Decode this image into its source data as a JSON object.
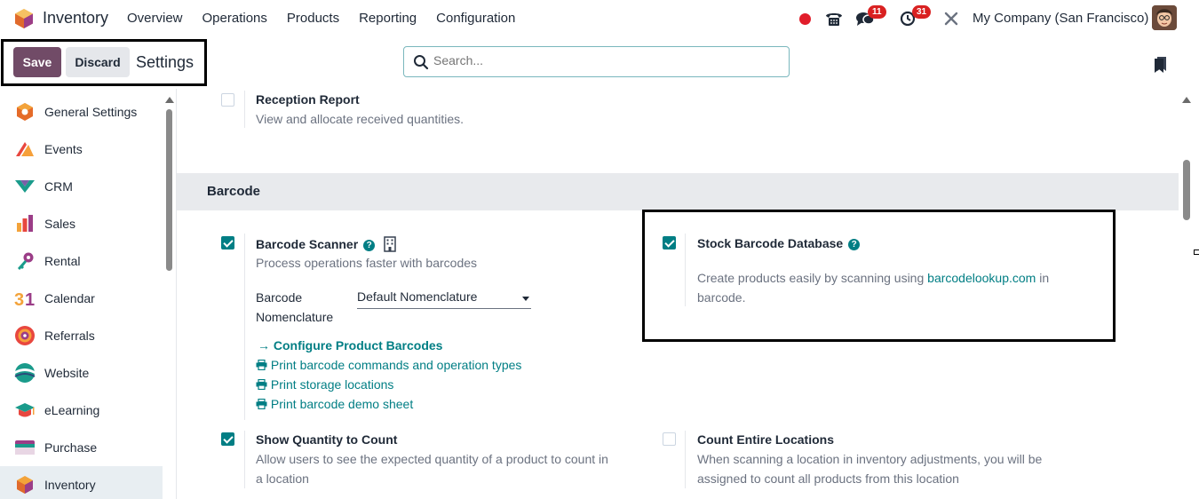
{
  "navbar": {
    "app_name": "Inventory",
    "menu": [
      "Overview",
      "Operations",
      "Products",
      "Reporting",
      "Configuration"
    ],
    "messages_count": "11",
    "activities_count": "31",
    "company": "My Company (San Francisco)"
  },
  "control_panel": {
    "save_label": "Save",
    "discard_label": "Discard",
    "title": "Settings",
    "search_placeholder": "Search..."
  },
  "sidebar": {
    "items": [
      {
        "label": "General Settings",
        "icon": "general-settings-icon"
      },
      {
        "label": "Events",
        "icon": "events-icon"
      },
      {
        "label": "CRM",
        "icon": "crm-icon"
      },
      {
        "label": "Sales",
        "icon": "sales-icon"
      },
      {
        "label": "Rental",
        "icon": "rental-icon"
      },
      {
        "label": "Calendar",
        "icon": "calendar-icon"
      },
      {
        "label": "Referrals",
        "icon": "referrals-icon"
      },
      {
        "label": "Website",
        "icon": "website-icon"
      },
      {
        "label": "eLearning",
        "icon": "elearning-icon"
      },
      {
        "label": "Purchase",
        "icon": "purchase-icon"
      },
      {
        "label": "Inventory",
        "icon": "inventory-icon",
        "active": true
      }
    ]
  },
  "content": {
    "reception_report": {
      "title": "Reception Report",
      "desc": "View and allocate received quantities.",
      "checked": false
    },
    "section_title": "Barcode",
    "barcode_scanner": {
      "title": "Barcode Scanner",
      "desc": "Process operations faster with barcodes",
      "checked": true,
      "nomenclature_label_1": "Barcode",
      "nomenclature_label_2": "Nomenclature",
      "nomenclature_value": "Default Nomenclature",
      "links": {
        "configure": "Configure Product Barcodes",
        "print_commands": "Print barcode commands and operation types",
        "print_locations": "Print storage locations",
        "print_demo": "Print barcode demo sheet"
      }
    },
    "stock_barcode_db": {
      "title": "Stock Barcode Database",
      "desc_before": "Create products easily by scanning using ",
      "desc_link": "barcodelookup.com",
      "desc_after": " in",
      "desc_line2": "barcode.",
      "checked": true
    },
    "show_quantity": {
      "title": "Show Quantity to Count",
      "desc_line1": "Allow users to see the expected quantity of a product to count in",
      "desc_line2": "a location",
      "checked": true
    },
    "count_entire": {
      "title": "Count Entire Locations",
      "desc_line1": "When scanning a location in inventory adjustments, you will be",
      "desc_line2": "assigned to count all products from this location",
      "checked": false
    }
  },
  "colors": {
    "brand": "#714b67",
    "accent": "#017e84",
    "badge": "#d92121"
  }
}
